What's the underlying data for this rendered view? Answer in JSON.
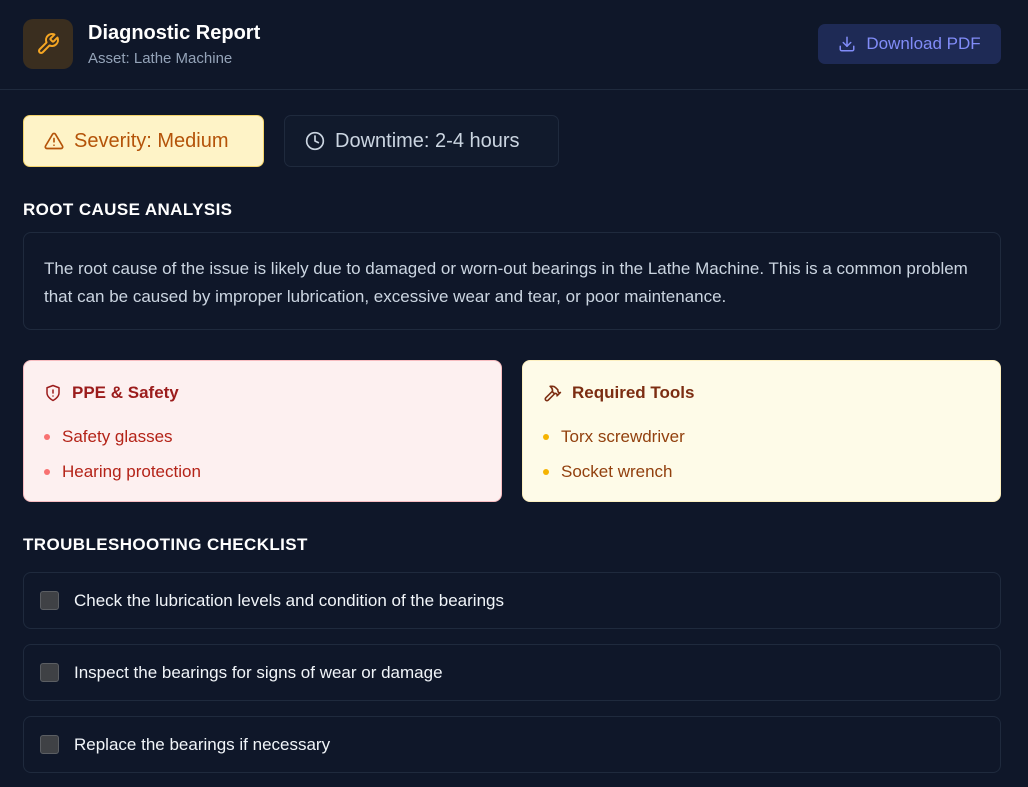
{
  "header": {
    "title": "Diagnostic Report",
    "subtitle": "Asset: Lathe Machine",
    "download_label": "Download PDF",
    "accent": "#818cf8",
    "logo_icon": "wrench-icon"
  },
  "badges": {
    "severity": "Severity: Medium",
    "downtime": "Downtime: 2-4 hours"
  },
  "root_cause": {
    "heading": "ROOT CAUSE ANALYSIS",
    "text": "The root cause of the issue is likely due to damaged or worn-out bearings in the Lathe Machine. This is a common problem that can be caused by improper lubrication, excessive wear and tear, or poor maintenance."
  },
  "ppe": {
    "heading": "PPE & Safety",
    "items": [
      "Safety glasses",
      "Hearing protection"
    ]
  },
  "tools": {
    "heading": "Required Tools",
    "items": [
      "Torx screwdriver",
      "Socket wrench"
    ]
  },
  "checklist": {
    "heading": "TROUBLESHOOTING CHECKLIST",
    "items": [
      {
        "label": "Check the lubrication levels and condition of the bearings",
        "checked": false
      },
      {
        "label": "Inspect the bearings for signs of wear or damage",
        "checked": false
      },
      {
        "label": "Replace the bearings if necessary",
        "checked": false
      }
    ]
  }
}
